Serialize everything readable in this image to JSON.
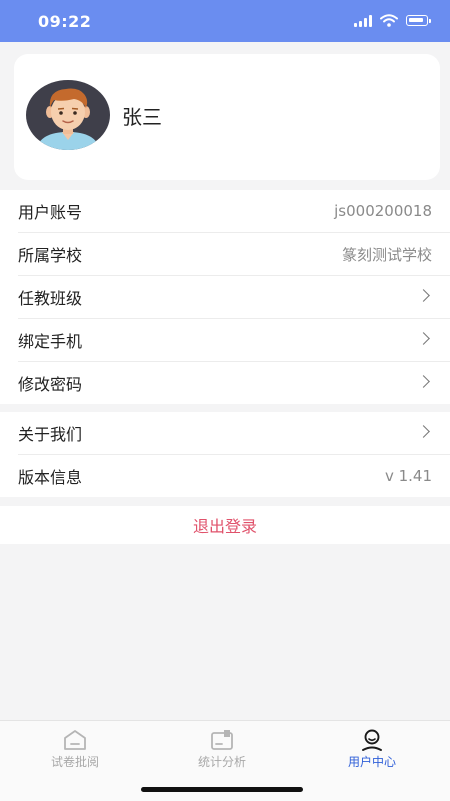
{
  "status_bar": {
    "time": "09:22"
  },
  "profile": {
    "name": "张三"
  },
  "info_rows": [
    {
      "label": "用户账号",
      "value": "js000200018"
    },
    {
      "label": "所属学校",
      "value": "篆刻测试学校"
    },
    {
      "label": "任教班级"
    },
    {
      "label": "绑定手机"
    },
    {
      "label": "修改密码"
    }
  ],
  "about_rows": [
    {
      "label": "关于我们"
    },
    {
      "label": "版本信息",
      "value": "v 1.41"
    }
  ],
  "logout_label": "退出登录",
  "tabs": [
    {
      "label": "试卷批阅",
      "icon": "home-icon"
    },
    {
      "label": "统计分析",
      "icon": "statistics-icon"
    },
    {
      "label": "用户中心",
      "icon": "user-icon",
      "active": true
    }
  ],
  "colors": {
    "status_bar": "#6a8df0",
    "accent": "#2f5fd8",
    "logout": "#e0526b"
  }
}
